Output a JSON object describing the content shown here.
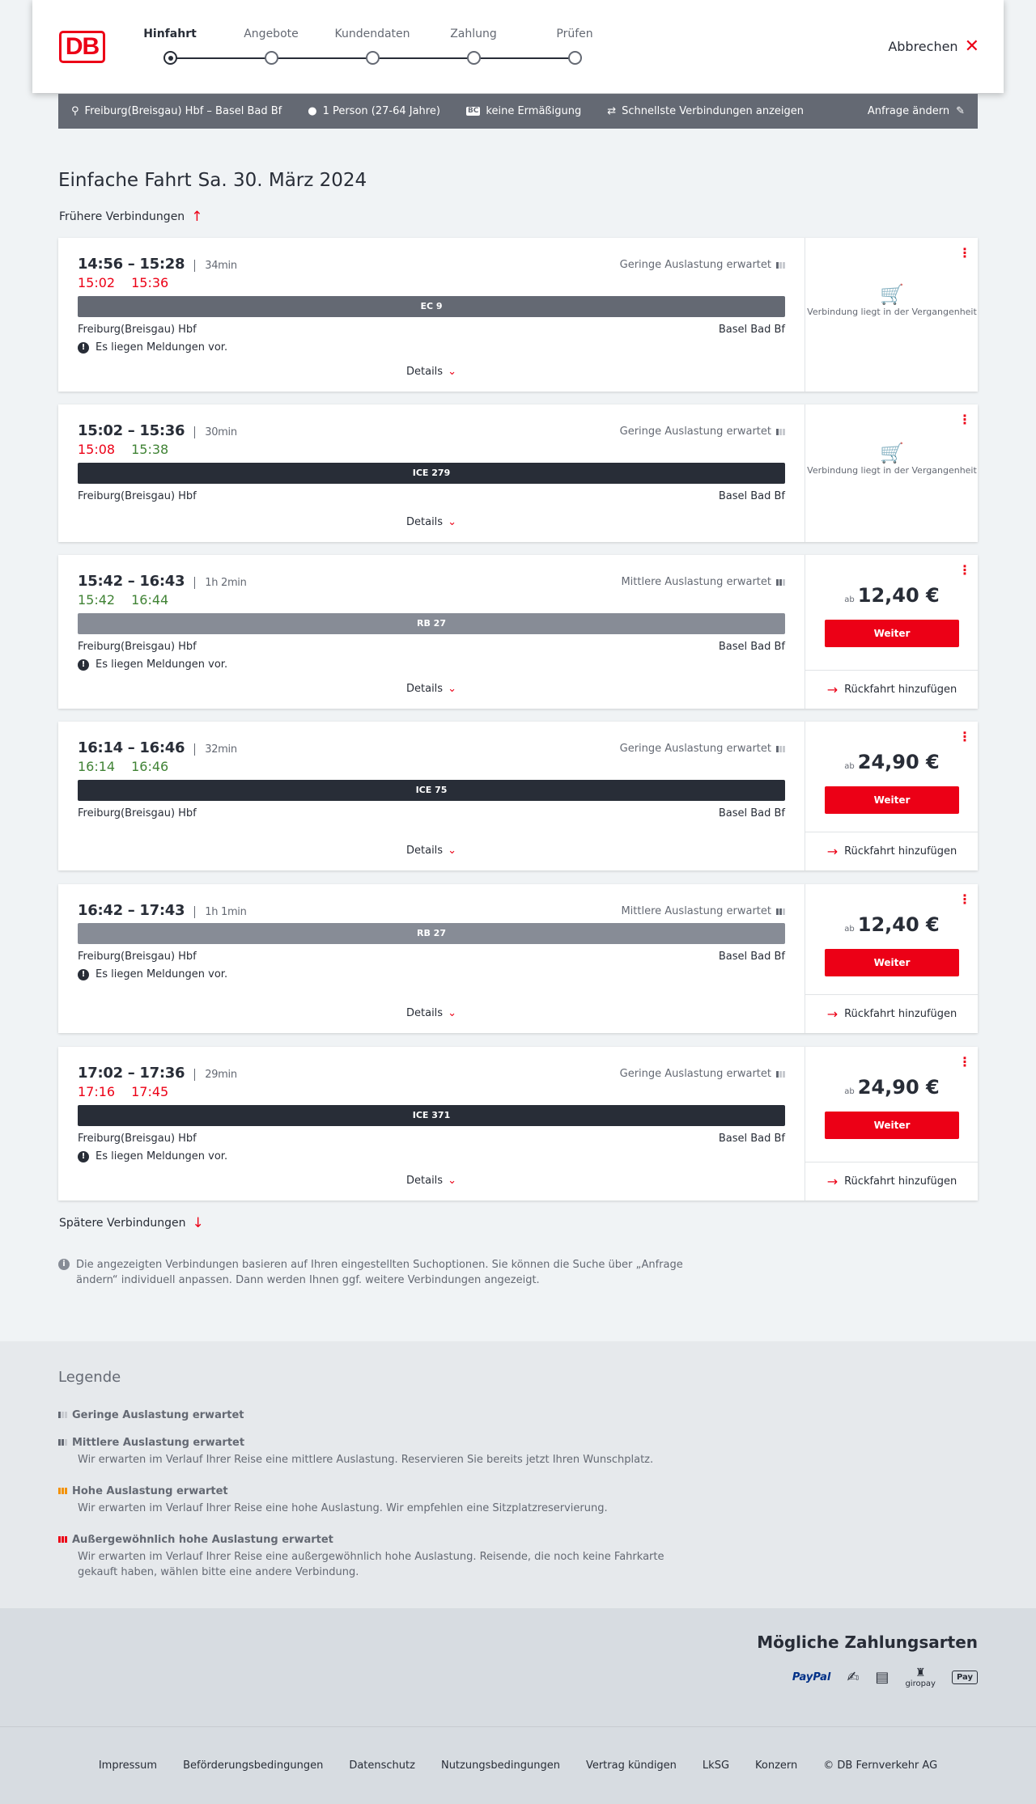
{
  "header": {
    "logo": "DB",
    "steps": [
      "Hinfahrt",
      "Angebote",
      "Kundendaten",
      "Zahlung",
      "Prüfen"
    ],
    "active_step": 0,
    "cancel_label": "Abbrechen"
  },
  "query": {
    "route": "Freiburg(Breisgau) Hbf – Basel Bad Bf",
    "passengers": "1 Person (27-64 Jahre)",
    "bc_badge": "BC",
    "discount": "keine Ermäßigung",
    "fastest": "Schnellste Verbindungen anzeigen",
    "change_label": "Anfrage ändern"
  },
  "page": {
    "title": "Einfache Fahrt",
    "date": "Sa. 30. März 2024",
    "earlier_label": "Frühere Verbindungen",
    "later_label": "Spätere Verbindungen",
    "details_label": "Details",
    "notice_label": "Es liegen Meldungen vor.",
    "past_label": "Verbindung liegt in der Vergangenheit",
    "from_station": "Freiburg(Breisgau) Hbf",
    "to_station": "Basel Bad Bf",
    "ab_label": "ab",
    "weiter_label": "Weiter",
    "return_label": "Rückfahrt hinzufügen"
  },
  "connections": [
    {
      "times": "14:56 – 15:28",
      "duration": "34min",
      "rt_dep": "15:02",
      "rt_arr": "15:36",
      "load": "Geringe Auslastung erwartet",
      "load_level": 1,
      "train": "EC 9",
      "train_color": "#646973",
      "notice": true,
      "status": "past"
    },
    {
      "times": "15:02 – 15:36",
      "duration": "30min",
      "rt_dep": "15:08",
      "rt_arr": "15:38",
      "load": "Geringe Auslastung erwartet",
      "load_level": 1,
      "train": "ICE 279",
      "train_color": "#282d37",
      "notice": false,
      "status": "past"
    },
    {
      "times": "15:42 – 16:43",
      "duration": "1h 2min",
      "rt_dep": "15:42",
      "rt_arr": "16:44",
      "load": "Mittlere Auslastung erwartet",
      "load_level": 2,
      "train": "RB 27",
      "train_color": "#878c96",
      "notice": true,
      "status": "bookable",
      "price": "12,40 €"
    },
    {
      "times": "16:14 – 16:46",
      "duration": "32min",
      "rt_dep": "16:14",
      "rt_arr": "16:46",
      "load": "Geringe Auslastung erwartet",
      "load_level": 1,
      "train": "ICE 75",
      "train_color": "#282d37",
      "notice": false,
      "status": "bookable",
      "price": "24,90 €"
    },
    {
      "times": "16:42 – 17:43",
      "duration": "1h 1min",
      "rt_dep": "",
      "rt_arr": "",
      "load": "Mittlere Auslastung erwartet",
      "load_level": 2,
      "train": "RB 27",
      "train_color": "#878c96",
      "notice": true,
      "status": "bookable",
      "price": "12,40 €"
    },
    {
      "times": "17:02 – 17:36",
      "duration": "29min",
      "rt_dep": "17:16",
      "rt_arr": "17:45",
      "load": "Geringe Auslastung erwartet",
      "load_level": 1,
      "train": "ICE 371",
      "train_color": "#282d37",
      "notice": true,
      "status": "bookable",
      "price": "24,90 €"
    }
  ],
  "info_text": "Die angezeigten Verbindungen basieren auf Ihren eingestellten Suchoptionen. Sie können die Suche über „Anfrage ändern“ individuell anpassen. Dann werden Ihnen ggf. weitere Verbindungen angezeigt.",
  "legend": {
    "title": "Legende",
    "items": [
      {
        "title": "Geringe Auslastung erwartet",
        "text": ""
      },
      {
        "title": "Mittlere Auslastung erwartet",
        "text": "Wir erwarten im Verlauf Ihrer Reise eine mittlere Auslastung. Reservieren Sie bereits jetzt Ihren Wunschplatz."
      },
      {
        "title": "Hohe Auslastung erwartet",
        "text": "Wir erwarten im Verlauf Ihrer Reise eine hohe Auslastung. Wir empfehlen eine Sitzplatzreservierung."
      },
      {
        "title": "Außergewöhnlich hohe Auslastung erwartet",
        "text": "Wir erwarten im Verlauf Ihrer Reise eine außergewöhnlich hohe Auslastung. Reisende, die noch keine Fahrkarte gekauft haben, wählen bitte eine andere Verbindung."
      }
    ]
  },
  "payment": {
    "title": "Mögliche Zahlungsarten",
    "methods": [
      "PayPal",
      "giropay",
      "Pay"
    ]
  },
  "footer": [
    "Impressum",
    "Beförderungsbedingungen",
    "Datenschutz",
    "Nutzungsbedingungen",
    "Vertrag kündigen",
    "LkSG",
    "Konzern",
    "© DB Fernverkehr AG"
  ],
  "colors": {
    "accent": "#ec0016",
    "late": "#ec0016",
    "on_time": "#408335",
    "text": "#282d37"
  }
}
